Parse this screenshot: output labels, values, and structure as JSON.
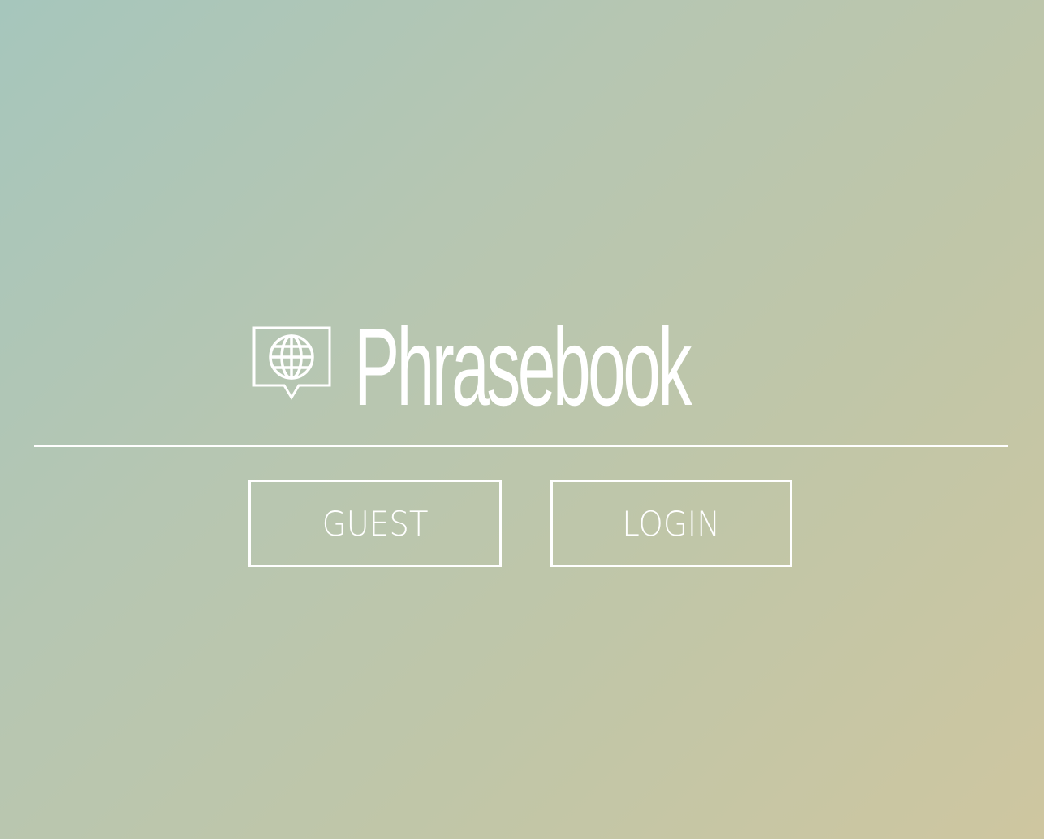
{
  "app": {
    "title": "Phrasebook",
    "logo_icon": "speech-bubble-globe-icon"
  },
  "actions": {
    "guest_label": "GUEST",
    "login_label": "LOGIN"
  },
  "colors": {
    "background_start": "#a6c6bc",
    "background_end": "#cec6a0",
    "foreground": "#ffffff"
  }
}
